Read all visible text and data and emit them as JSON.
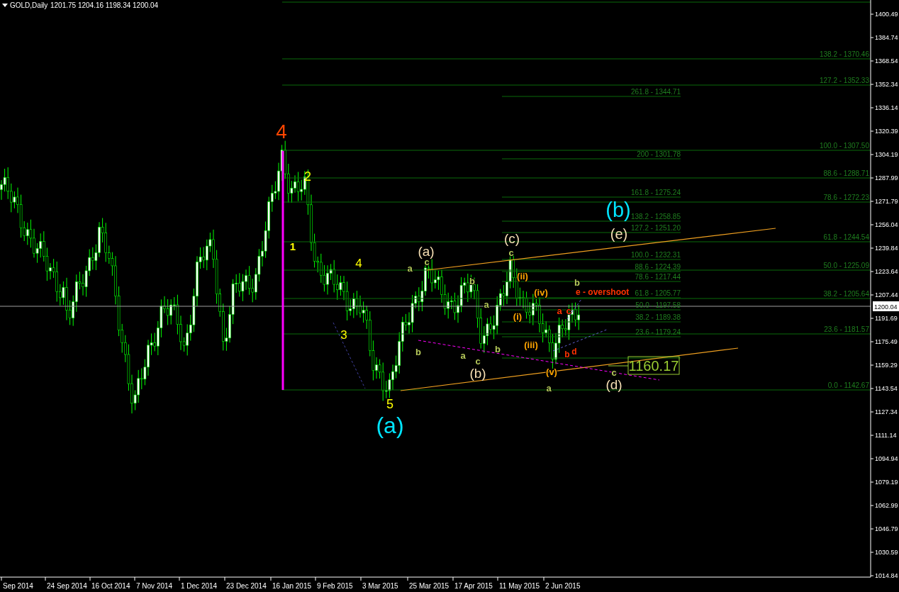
{
  "header": {
    "symbol": "GOLD,Daily",
    "ohlc": "1201.75 1204.16 1198.34 1200.04"
  },
  "price_axis": {
    "ticks": [
      "1400.49",
      "1384.74",
      "1368.54",
      "1352.34",
      "1336.14",
      "1320.39",
      "1304.19",
      "1287.99",
      "1271.79",
      "1256.04",
      "1239.84",
      "1223.64",
      "1207.44",
      "1191.69",
      "1175.49",
      "1159.29",
      "1143.54",
      "1127.34",
      "1111.14",
      "1094.94",
      "1079.19",
      "1062.99",
      "1046.79",
      "1030.59",
      "1014.84"
    ],
    "current_price": "1200.04"
  },
  "time_axis": {
    "labels": [
      "Sep 2014",
      "24 Sep 2014",
      "16 Oct 2014",
      "7 Nov 2014",
      "1 Dec 2014",
      "23 Dec 2014",
      "16 Jan 2015",
      "9 Feb 2015",
      "3 Mar 2015",
      "25 Mar 2015",
      "17 Apr 2015",
      "11 May 2015",
      "2 Jun 2015"
    ]
  },
  "fibonacci_right": [
    "138.2 - 1370.46",
    "127.2 - 1352.33",
    "100.0 - 1307.50",
    "88.6 - 1288.71",
    "78.6 - 1272.23",
    "61.8 - 1244.54",
    "50.0 - 1225.09",
    "38.2 - 1205.64",
    "23.6  - 1181.57",
    "0.0 - 1142.67"
  ],
  "fibonacci_left": [
    "261.8 - 1344.71",
    "200 - 1301.78",
    "161.8 - 1275.24",
    "138.2 - 1258.85",
    "127.2 - 1251.20",
    "100.0 - 1232.31",
    "88.6 - 1224.39",
    "78.6 - 1217.44",
    "61.8 - 1205.77",
    "50.0 - 1197.58",
    "38.2 - 1189.38",
    "23.6  - 1179.24"
  ],
  "wave_labels": [
    {
      "text": "4",
      "color": "#ff4500"
    },
    {
      "text": "2",
      "color": "#ffff00"
    },
    {
      "text": "1",
      "color": "#ffff00"
    },
    {
      "text": "4",
      "color": "#ffff00"
    },
    {
      "text": "3",
      "color": "#ffff00"
    },
    {
      "text": "5",
      "color": "#ffff00"
    },
    {
      "text": "(a)",
      "color": "#00e5ff"
    },
    {
      "text": "(b)",
      "color": "#00e5ff"
    },
    {
      "text": "(e)",
      "color": "#f5deb3"
    },
    {
      "text": "(a)",
      "color": "#f5deb3"
    },
    {
      "text": "(c)",
      "color": "#f5deb3"
    },
    {
      "text": "(b)",
      "color": "#f5deb3"
    },
    {
      "text": "(d)",
      "color": "#f5deb3"
    },
    {
      "text": "a",
      "color": "#b5c95a"
    },
    {
      "text": "c",
      "color": "#b5c95a"
    },
    {
      "text": "c",
      "color": "#b5c95a"
    },
    {
      "text": "b",
      "color": "#b5c95a"
    },
    {
      "text": "a",
      "color": "#b5c95a"
    },
    {
      "text": "b",
      "color": "#b5c95a"
    },
    {
      "text": "a",
      "color": "#b5c95a"
    },
    {
      "text": "c",
      "color": "#b5c95a"
    },
    {
      "text": "b",
      "color": "#b5c95a"
    },
    {
      "text": "b",
      "color": "#b5c95a"
    },
    {
      "text": "a",
      "color": "#b5c95a"
    },
    {
      "text": "c",
      "color": "#b5c95a"
    },
    {
      "text": "(ii)",
      "color": "#ffa500"
    },
    {
      "text": "(iv)",
      "color": "#ffa500"
    },
    {
      "text": "(i)",
      "color": "#ffa500"
    },
    {
      "text": "(iii)",
      "color": "#ffa500"
    },
    {
      "text": "(v)",
      "color": "#ffa500"
    },
    {
      "text": "a",
      "color": "#ff3300"
    },
    {
      "text": "c",
      "color": "#ff3300"
    },
    {
      "text": "b",
      "color": "#ff3300"
    },
    {
      "text": "d",
      "color": "#ff3300"
    },
    {
      "text": "e - overshoot",
      "color": "#ff3300"
    }
  ],
  "price_box": "1160.17"
}
